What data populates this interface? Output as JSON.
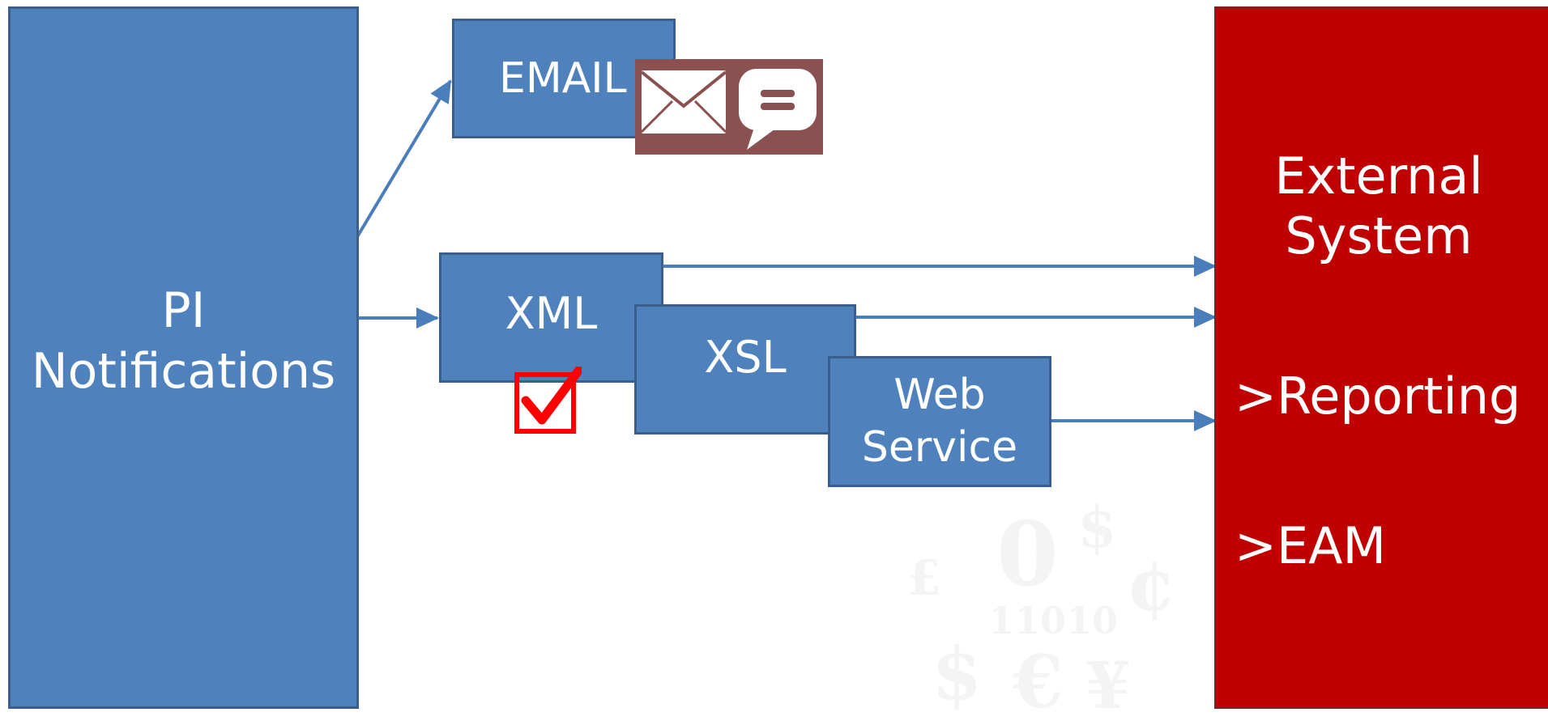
{
  "nodes": {
    "pi_notifications": "PI\nNotifications",
    "email": "EMAIL",
    "xml": "XML",
    "xsl": "XSL",
    "web_service": "Web\nService",
    "external_system": {
      "title": "External\nSystem",
      "items": [
        ">Reporting",
        ">EAM"
      ]
    }
  },
  "icons": {
    "message": "mail-and-chat-icon",
    "check": "checkbox-checked-icon"
  },
  "colors": {
    "blue_box": "#4f81bd",
    "blue_border": "#3a5f8c",
    "arrow": "#4a7ebb",
    "external_red": "#c00000",
    "icon_bg": "#8b5150",
    "check_red": "#ff0000"
  }
}
